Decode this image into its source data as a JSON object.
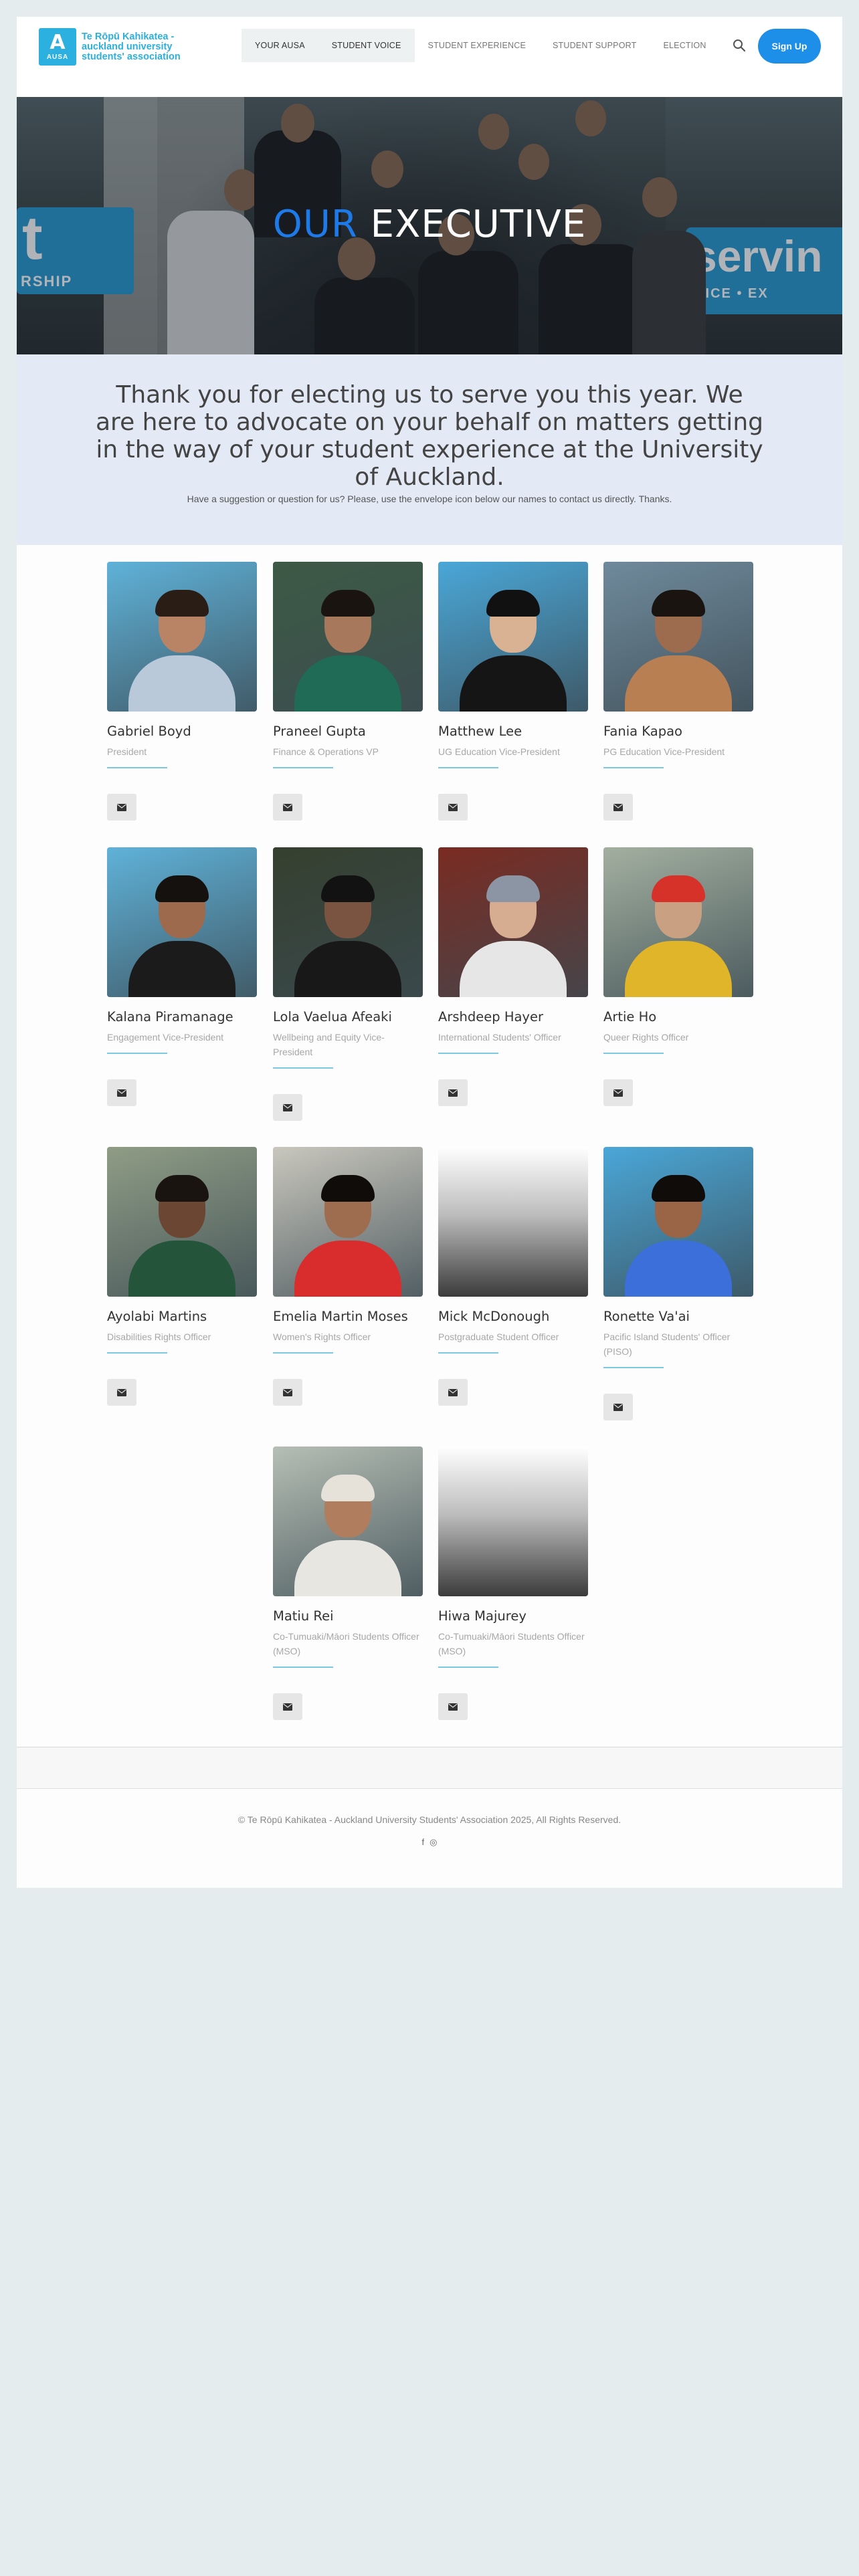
{
  "header": {
    "logo_text": [
      "Te Rōpū Kahikatea -",
      "auckland university",
      "students' association"
    ],
    "logo_badge": "AUSA",
    "nav": [
      {
        "label": "YOUR AUSA",
        "active": true
      },
      {
        "label": "STUDENT VOICE",
        "active": true
      },
      {
        "label": "STUDENT EXPERIENCE",
        "active": false
      },
      {
        "label": "STUDENT SUPPORT",
        "active": false
      },
      {
        "label": "ELECTION",
        "active": false
      }
    ],
    "search_icon": "search-icon",
    "signup_label": "Sign Up",
    "accent": "#1d8fe8"
  },
  "hero": {
    "title_highlight": "OUR",
    "title_rest": "EXECUTIVE",
    "highlight_color": "#1d7ae8",
    "sign_left": [
      "t",
      "RSHIP"
    ],
    "sign_right": [
      "servin",
      "OICE • EX"
    ]
  },
  "intro": {
    "heading": "Thank you for electing us to serve you this year. We are here to advocate on your behalf on matters getting in the way of your student experience at the University of Auckland.",
    "subtext": "Have a suggestion or question for us? Please, use the envelope icon below our names to contact us directly. Thanks."
  },
  "members": [
    {
      "name": "Gabriel Boyd",
      "role": "President",
      "photo": "photo"
    },
    {
      "name": "Praneel Gupta",
      "role": "Finance & Operations VP",
      "photo": "photo"
    },
    {
      "name": "Matthew Lee",
      "role": "UG Education Vice-President",
      "photo": "photo"
    },
    {
      "name": "Fania Kapao",
      "role": "PG Education Vice-President",
      "photo": "photo"
    },
    {
      "name": "Kalana Piramanage",
      "role": "Engagement Vice-President",
      "photo": "photo"
    },
    {
      "name": "Lola Vaelua Afeaki",
      "role": "Wellbeing and Equity Vice-President",
      "photo": "photo"
    },
    {
      "name": "Arshdeep Hayer",
      "role": "International Students' Officer",
      "photo": "photo"
    },
    {
      "name": "Artie Ho",
      "role": "Queer Rights Officer",
      "photo": "photo"
    },
    {
      "name": "Ayolabi Martins",
      "role": "Disabilities Rights Officer",
      "photo": "photo"
    },
    {
      "name": "Emelia Martin Moses",
      "role": "Women's Rights Officer",
      "photo": "photo"
    },
    {
      "name": "Mick McDonough",
      "role": "Postgraduate Student Officer",
      "photo": "placeholder"
    },
    {
      "name": "Ronette Va'ai",
      "role": "Pacific Island Students' Officer (PISO)",
      "photo": "photo"
    },
    {
      "name": "Matiu Rei",
      "role": "Co-Tumuaki/Māori Students Officer (MSO)",
      "photo": "photo"
    },
    {
      "name": "Hiwa Majurey",
      "role": "Co-Tumuaki/Māori Students Officer (MSO)",
      "photo": "placeholder"
    }
  ],
  "contact_icon": "envelope-icon",
  "footer": {
    "copyright": "© Te Rōpū Kahikatea - Auckland University Students' Association 2025, All Rights Reserved.",
    "social_icons": [
      "facebook-icon",
      "instagram-icon"
    ],
    "social_glyphs": [
      "f",
      "◎"
    ]
  }
}
